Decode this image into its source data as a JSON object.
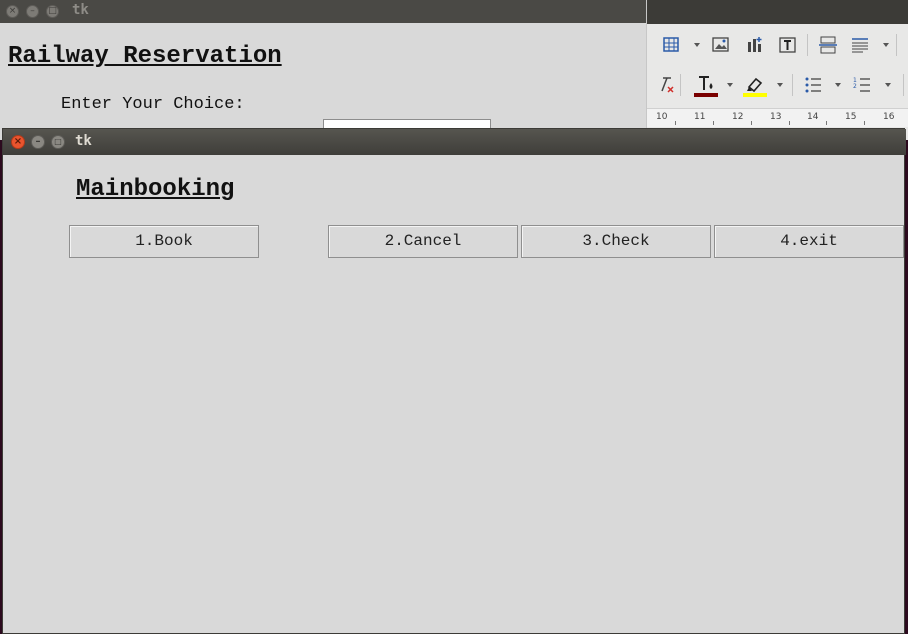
{
  "background_window": {
    "title": "tk",
    "heading": "Railway Reservation",
    "prompt_label": "Enter Your Choice:",
    "choice_value": ""
  },
  "office_toolbar": {
    "row1_icons": [
      "insert-table-icon",
      "insert-image-icon",
      "insert-chart-icon",
      "insert-textbox-icon",
      "page-break-icon",
      "insert-field-icon"
    ],
    "row2_icons": [
      "clear-formatting-icon",
      "font-color-icon",
      "highlight-color-icon",
      "bullet-list-icon",
      "numbered-list-icon"
    ],
    "font_color": "#7a0000",
    "highlight_color": "#ffff00",
    "ruler_numbers": [
      "10",
      "11",
      "12",
      "13",
      "14",
      "15",
      "16"
    ]
  },
  "foreground_window": {
    "title": "tk",
    "heading": "Mainbooking",
    "buttons": [
      {
        "label": "1.Book"
      },
      {
        "label": "2.Cancel"
      },
      {
        "label": "3.Check"
      },
      {
        "label": "4.exit"
      }
    ]
  },
  "colors": {
    "window_bg": "#d9d9d9",
    "titlebar": "#3f3e3a",
    "close_button": "#e9542e"
  }
}
